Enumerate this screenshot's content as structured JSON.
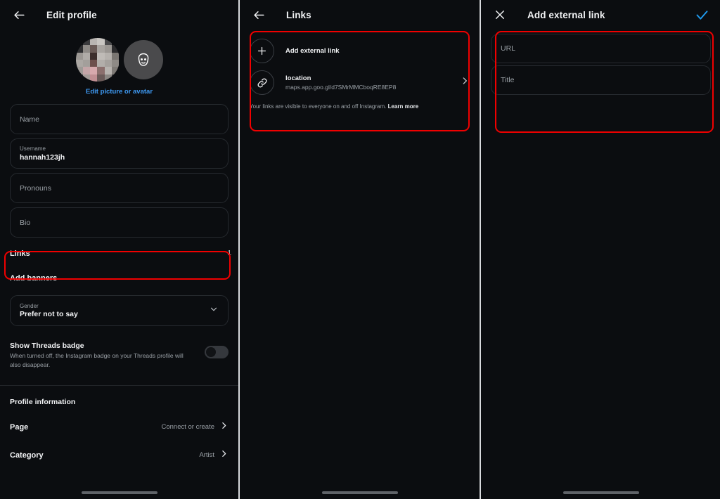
{
  "colors": {
    "background": "#0b0d10",
    "highlight": "#f00000",
    "accent_blue": "#3f9bf5",
    "check_blue": "#1f9bf0",
    "text_primary": "#f2f3f5",
    "text_secondary": "#9aa0a6",
    "field_border": "#262a2f",
    "divider": "#d8dadd"
  },
  "panel1": {
    "header": {
      "back_icon": "arrow-left-icon",
      "title": "Edit profile"
    },
    "avatar": {
      "photo_alt": "profile-photo-blurred",
      "avatar_icon": "avatar-face-icon",
      "edit_link": "Edit picture or avatar"
    },
    "fields": [
      {
        "label": "Name",
        "value": ""
      },
      {
        "label": "Username",
        "value": "hannah123jh"
      },
      {
        "label": "Pronouns",
        "value": ""
      },
      {
        "label": "Bio",
        "value": ""
      }
    ],
    "links_row": {
      "label": "Links",
      "count": "1"
    },
    "add_banners": "Add banners",
    "gender": {
      "label": "Gender",
      "value": "Prefer not to say",
      "chevron_icon": "chevron-down-icon"
    },
    "threads": {
      "title": "Show Threads badge",
      "description": "When turned off, the Instagram badge on your Threads profile will also disappear.",
      "toggle_state": "off"
    },
    "profile_information": {
      "section_title": "Profile information",
      "rows": [
        {
          "label": "Page",
          "value": "Connect or create",
          "chevron_icon": "chevron-right-icon"
        },
        {
          "label": "Category",
          "value": "Artist",
          "chevron_icon": "chevron-right-icon"
        }
      ]
    }
  },
  "panel2": {
    "header": {
      "back_icon": "arrow-left-icon",
      "title": "Links"
    },
    "items": [
      {
        "icon": "plus-icon",
        "title": "Add external link",
        "subtitle": "",
        "chevron": false
      },
      {
        "icon": "link-chain-icon",
        "title": "location",
        "subtitle": "maps.app.goo.gl/d7SMrMMCboqRE8EP8",
        "chevron": true,
        "chevron_icon": "chevron-right-icon"
      }
    ],
    "note_text": "Your links are visible to everyone on and off Instagram.",
    "note_link": "Learn more"
  },
  "panel3": {
    "header": {
      "close_icon": "close-x-icon",
      "title": "Add external link",
      "confirm_icon": "checkmark-icon"
    },
    "inputs": [
      {
        "placeholder": "URL",
        "value": ""
      },
      {
        "placeholder": "Title",
        "value": ""
      }
    ]
  }
}
